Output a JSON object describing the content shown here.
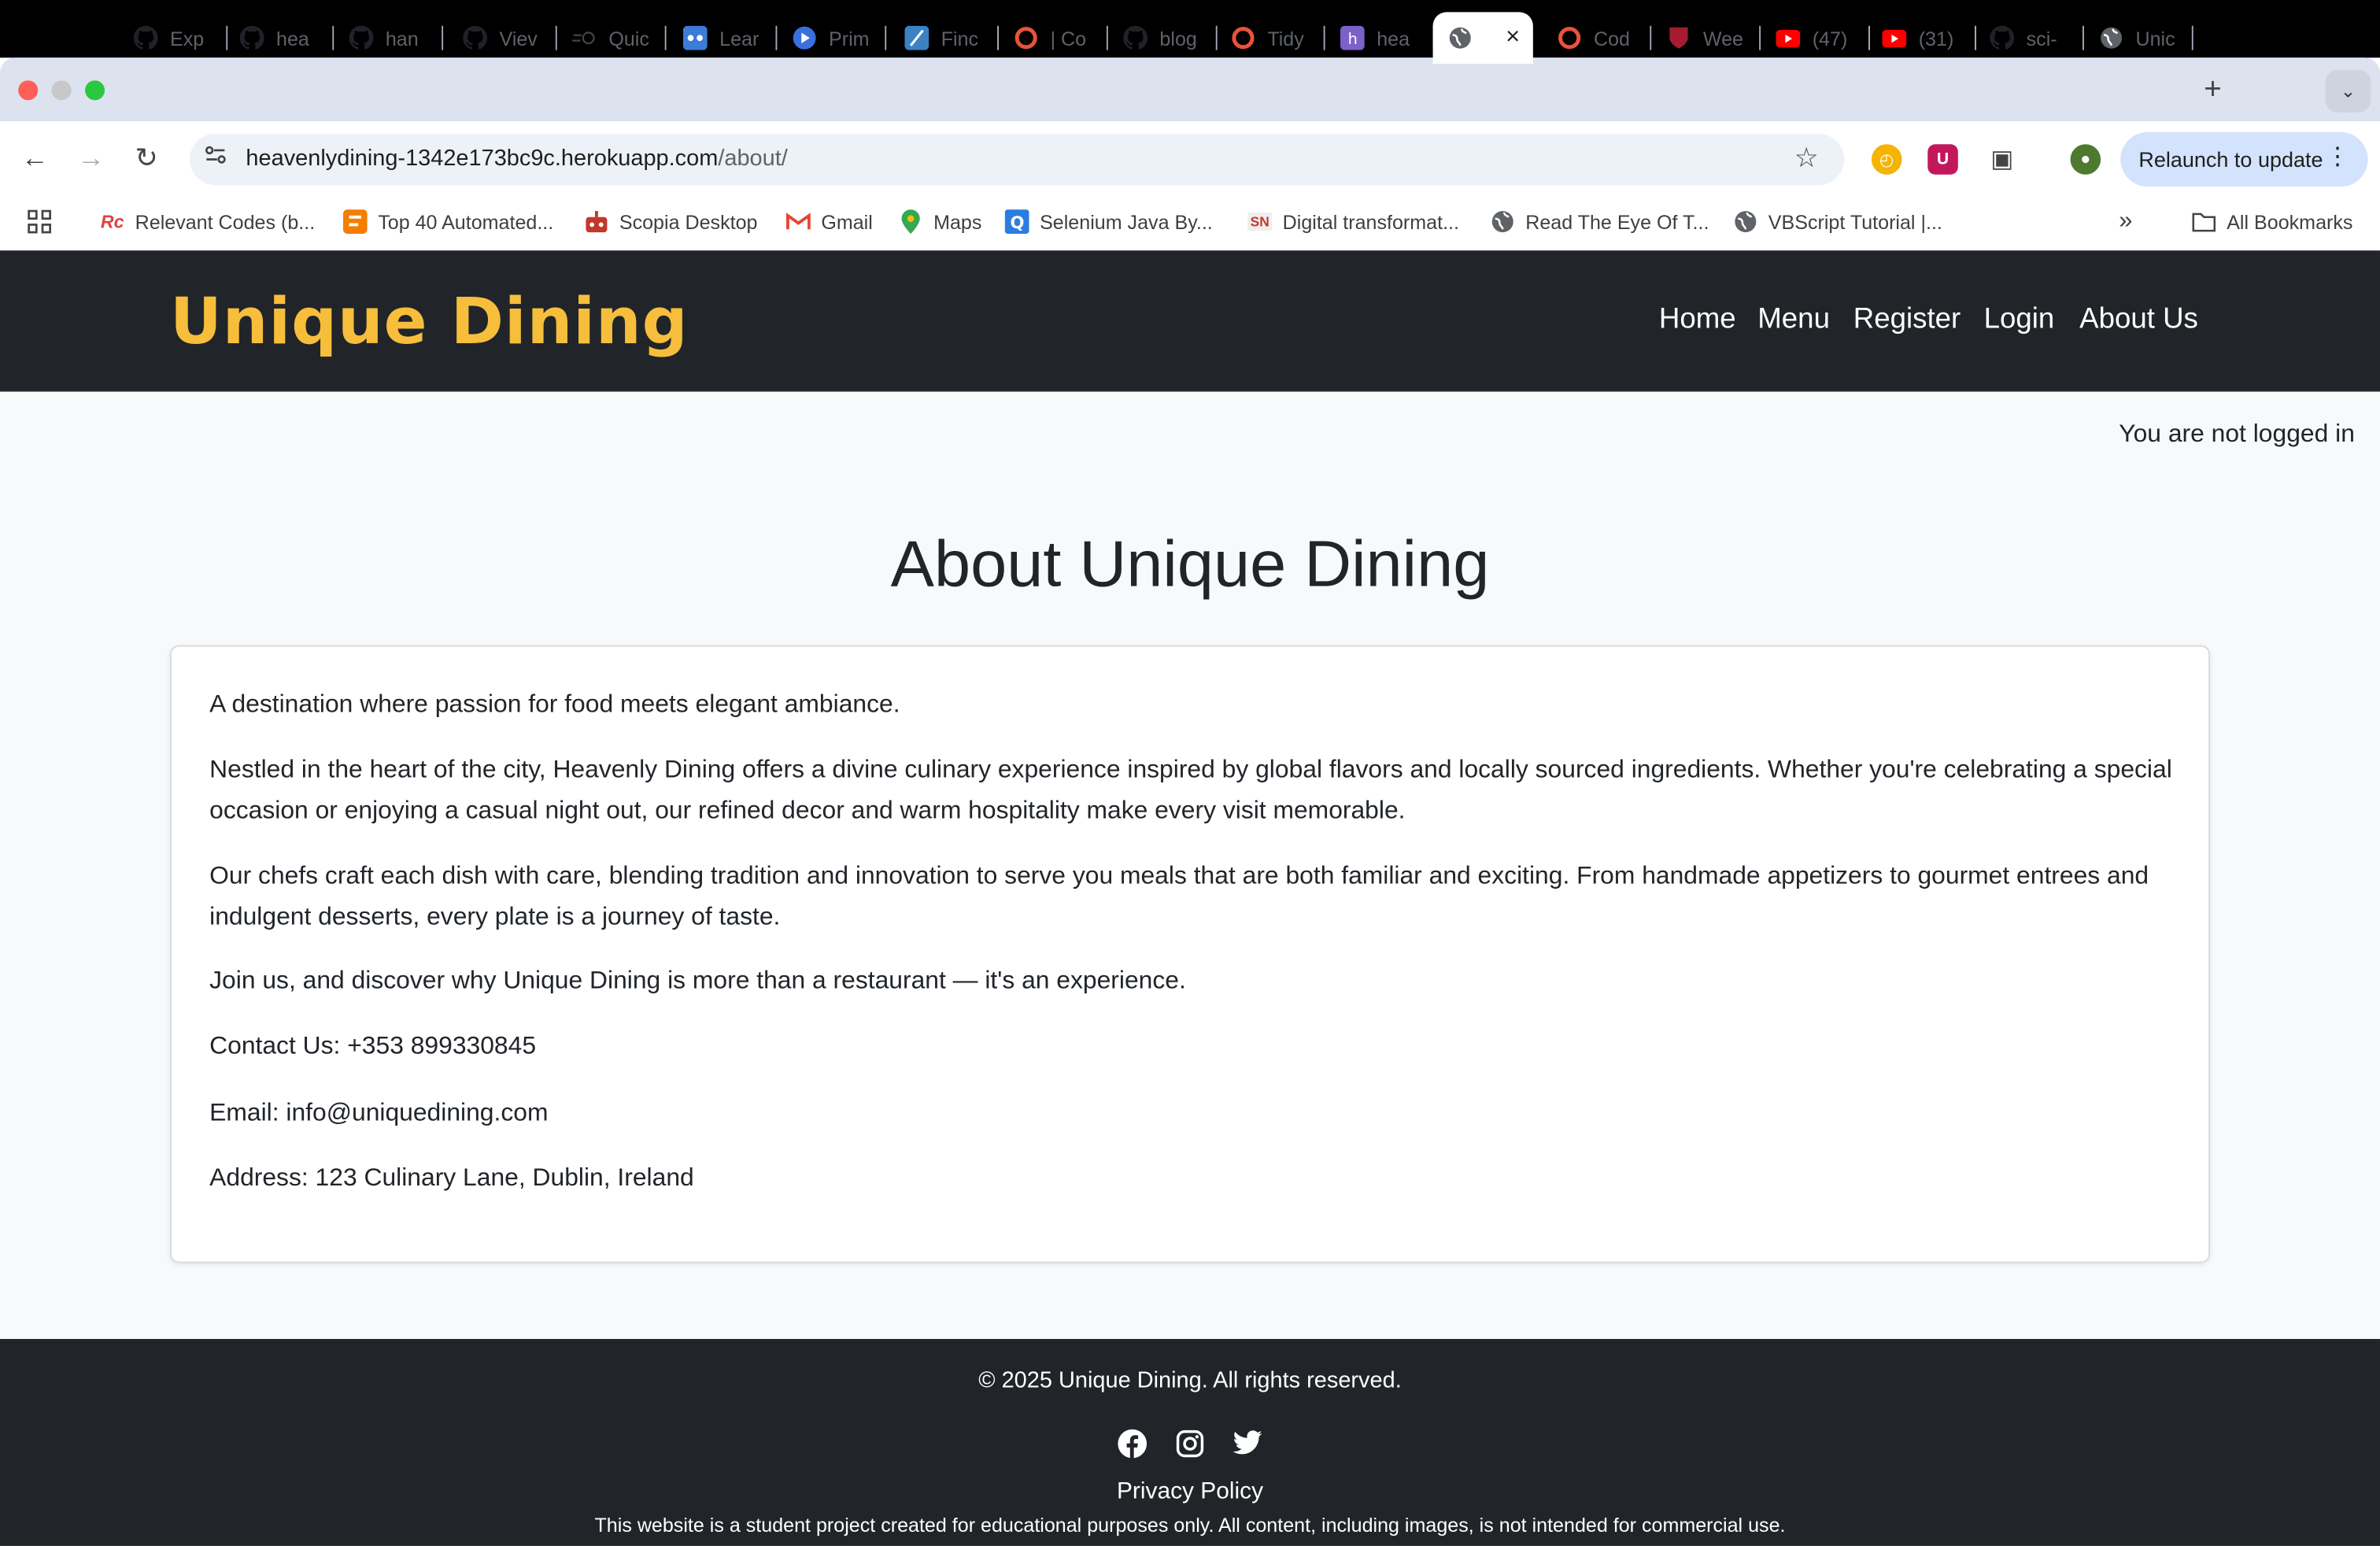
{
  "browser": {
    "tabs": [
      {
        "label": "Exp",
        "icon": "github-icon"
      },
      {
        "label": "hea",
        "icon": "github-icon"
      },
      {
        "label": "han",
        "icon": "github-icon"
      },
      {
        "label": "Viev",
        "icon": "github-icon"
      },
      {
        "label": "Quic",
        "icon": "quickstart-icon"
      },
      {
        "label": "Lear",
        "icon": "learn-icon"
      },
      {
        "label": "Prim",
        "icon": "play-icon"
      },
      {
        "label": "Finc",
        "icon": "feather-icon"
      },
      {
        "label": "| Co",
        "icon": "ring-icon"
      },
      {
        "label": "blog",
        "icon": "github-icon"
      },
      {
        "label": "Tidy",
        "icon": "ring-icon"
      },
      {
        "label": "hea",
        "icon": "heroku-icon"
      },
      {
        "label": "",
        "icon": "globe-icon"
      },
      {
        "label": "Cod",
        "icon": "ring-icon"
      },
      {
        "label": "Wee",
        "icon": "shield-icon"
      },
      {
        "label": "(47)",
        "icon": "youtube-icon"
      },
      {
        "label": "(31)",
        "icon": "youtube-icon"
      },
      {
        "label": "sci-",
        "icon": "github-icon"
      },
      {
        "label": "Unic",
        "icon": "globe-icon"
      }
    ],
    "new_tab": "+",
    "url_host": "heavenlydining-1342e173bc9c.herokuapp.com",
    "url_path": "/about/",
    "relaunch": "Relaunch to update",
    "bookmarks": [
      {
        "label": "Relevant Codes (b...",
        "icon": "rc-icon"
      },
      {
        "label": "Top 40 Automated...",
        "icon": "blogger-icon"
      },
      {
        "label": "Scopia Desktop",
        "icon": "robot-icon"
      },
      {
        "label": "Gmail",
        "icon": "gmail-icon"
      },
      {
        "label": "Maps",
        "icon": "maps-icon"
      },
      {
        "label": "Selenium Java By...",
        "icon": "q-icon"
      },
      {
        "label": "Digital transformat...",
        "icon": "sn-icon"
      },
      {
        "label": "Read The Eye Of T...",
        "icon": "globe-icon"
      },
      {
        "label": "VBScript Tutorial |...",
        "icon": "globe-icon"
      }
    ],
    "all_bookmarks": "All Bookmarks",
    "more_bookmarks": "»"
  },
  "site": {
    "brand": "Unique Dining",
    "nav": [
      "Home",
      "Menu",
      "Register",
      "Login",
      "About Us"
    ],
    "login_status": "You are not logged in",
    "title": "About Unique Dining",
    "paragraphs": [
      "A destination where passion for food meets elegant ambiance.",
      "Nestled in the heart of the city, Heavenly Dining offers a divine culinary experience inspired by global flavors and locally sourced ingredients. Whether you're celebrating a special occasion or enjoying a casual night out, our refined decor and warm hospitality make every visit memorable.",
      "Our chefs craft each dish with care, blending tradition and innovation to serve you meals that are both familiar and exciting. From handmade appetizers to gourmet entrees and indulgent desserts, every plate is a journey of taste.",
      "Join us, and discover why Unique Dining is more than a restaurant — it's an experience.",
      "Contact Us: +353 899330845",
      "Email: info@uniquedining.com",
      "Address: 123 Culinary Lane, Dublin, Ireland"
    ],
    "footer": {
      "copyright": "© 2025 Unique Dining. All rights reserved.",
      "social": [
        "facebook-icon",
        "instagram-icon",
        "twitter-icon"
      ],
      "privacy": "Privacy Policy",
      "disclaimer": "This website is a student project created for educational purposes only. All content, including images, is not intended for commercial use."
    },
    "colors": {
      "brand": "#f7be3c",
      "header_bg": "#212529",
      "page_bg": "#f8f9fa"
    }
  }
}
